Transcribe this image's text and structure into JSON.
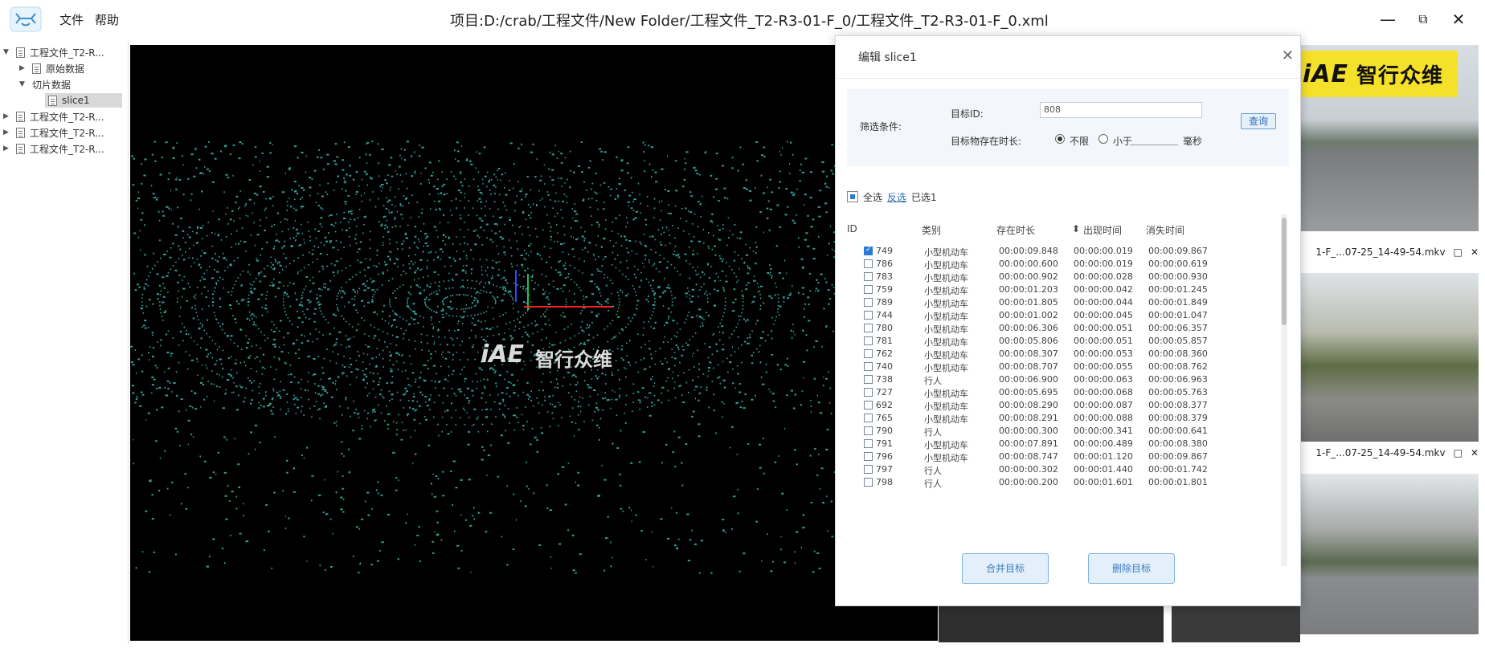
{
  "app": {
    "menu": [
      "文件",
      "帮助"
    ],
    "window_title": "项目:D:/crab/工程文件/New Folder/工程文件_T2-R3-01-F_0/工程文件_T2-R3-01-F_0.xml"
  },
  "tree": {
    "items": [
      {
        "label": "工程文件_T2-R...",
        "level": 0,
        "expanded": true
      },
      {
        "label": "原始数据",
        "level": 1,
        "expanded": false
      },
      {
        "label": "切片数据",
        "level": 1,
        "expanded": true
      },
      {
        "label": "slice1",
        "level": 2,
        "selected": true
      },
      {
        "label": "工程文件_T2-R...",
        "level": 0,
        "expanded": false
      },
      {
        "label": "工程文件_T2-R...",
        "level": 0,
        "expanded": false
      },
      {
        "label": "工程文件_T2-R...",
        "level": 0,
        "expanded": false
      }
    ]
  },
  "viewer": {
    "watermark_latin": "iAE",
    "watermark_cn": "智行众维"
  },
  "brand": {
    "latin": "iAE",
    "cn": "智行众维"
  },
  "videos": {
    "pane2_title": "1-F_...07-25_14-49-54.mkv",
    "pane3_title": "1-F_...07-25_14-49-54.mkv"
  },
  "dialog": {
    "title": "编辑 slice1",
    "filter_label": "筛选条件:",
    "target_id_label": "目标ID:",
    "target_id_value": "808",
    "exist_label": "目标物存在时长:",
    "opt_unlimited": "不限",
    "opt_less": "小于",
    "unit_ms": "毫秒",
    "query_btn": "查询",
    "select_all": "全选",
    "invert": "反选",
    "selected_count": "已选1",
    "columns": [
      "ID",
      "类别",
      "存在时长",
      "出现时间",
      "消失时间"
    ],
    "rows": [
      {
        "id": "749",
        "cls": "小型机动车",
        "dur": "00:00:09.848",
        "start": "00:00:00.019",
        "end": "00:00:09.867",
        "checked": true
      },
      {
        "id": "786",
        "cls": "小型机动车",
        "dur": "00:00:00.600",
        "start": "00:00:00.019",
        "end": "00:00:00.619",
        "checked": false
      },
      {
        "id": "783",
        "cls": "小型机动车",
        "dur": "00:00:00.902",
        "start": "00:00:00.028",
        "end": "00:00:00.930",
        "checked": false
      },
      {
        "id": "759",
        "cls": "小型机动车",
        "dur": "00:00:01.203",
        "start": "00:00:00.042",
        "end": "00:00:01.245",
        "checked": false
      },
      {
        "id": "789",
        "cls": "小型机动车",
        "dur": "00:00:01.805",
        "start": "00:00:00.044",
        "end": "00:00:01.849",
        "checked": false
      },
      {
        "id": "744",
        "cls": "小型机动车",
        "dur": "00:00:01.002",
        "start": "00:00:00.045",
        "end": "00:00:01.047",
        "checked": false
      },
      {
        "id": "780",
        "cls": "小型机动车",
        "dur": "00:00:06.306",
        "start": "00:00:00.051",
        "end": "00:00:06.357",
        "checked": false
      },
      {
        "id": "781",
        "cls": "小型机动车",
        "dur": "00:00:05.806",
        "start": "00:00:00.051",
        "end": "00:00:05.857",
        "checked": false
      },
      {
        "id": "762",
        "cls": "小型机动车",
        "dur": "00:00:08.307",
        "start": "00:00:00.053",
        "end": "00:00:08.360",
        "checked": false
      },
      {
        "id": "740",
        "cls": "小型机动车",
        "dur": "00:00:08.707",
        "start": "00:00:00.055",
        "end": "00:00:08.762",
        "checked": false
      },
      {
        "id": "738",
        "cls": "行人",
        "dur": "00:00:06.900",
        "start": "00:00:00.063",
        "end": "00:00:06.963",
        "checked": false
      },
      {
        "id": "727",
        "cls": "小型机动车",
        "dur": "00:00:05.695",
        "start": "00:00:00.068",
        "end": "00:00:05.763",
        "checked": false
      },
      {
        "id": "692",
        "cls": "小型机动车",
        "dur": "00:00:08.290",
        "start": "00:00:00.087",
        "end": "00:00:08.377",
        "checked": false
      },
      {
        "id": "765",
        "cls": "小型机动车",
        "dur": "00:00:08.291",
        "start": "00:00:00.088",
        "end": "00:00:08.379",
        "checked": false
      },
      {
        "id": "790",
        "cls": "行人",
        "dur": "00:00:00.300",
        "start": "00:00:00.341",
        "end": "00:00:00.641",
        "checked": false
      },
      {
        "id": "791",
        "cls": "小型机动车",
        "dur": "00:00:07.891",
        "start": "00:00:00.489",
        "end": "00:00:08.380",
        "checked": false
      },
      {
        "id": "796",
        "cls": "小型机动车",
        "dur": "00:00:08.747",
        "start": "00:00:01.120",
        "end": "00:00:09.867",
        "checked": false
      },
      {
        "id": "797",
        "cls": "行人",
        "dur": "00:00:00.302",
        "start": "00:00:01.440",
        "end": "00:00:01.742",
        "checked": false
      },
      {
        "id": "798",
        "cls": "行人",
        "dur": "00:00:00.200",
        "start": "00:00:01.601",
        "end": "00:00:01.801",
        "checked": false
      }
    ],
    "merge_btn": "合并目标",
    "delete_btn": "删除目标"
  },
  "colors": {
    "point_cloud": "#3fc4b8",
    "brand_yellow": "#f5e12a",
    "accent_blue": "#2d7bd0"
  }
}
